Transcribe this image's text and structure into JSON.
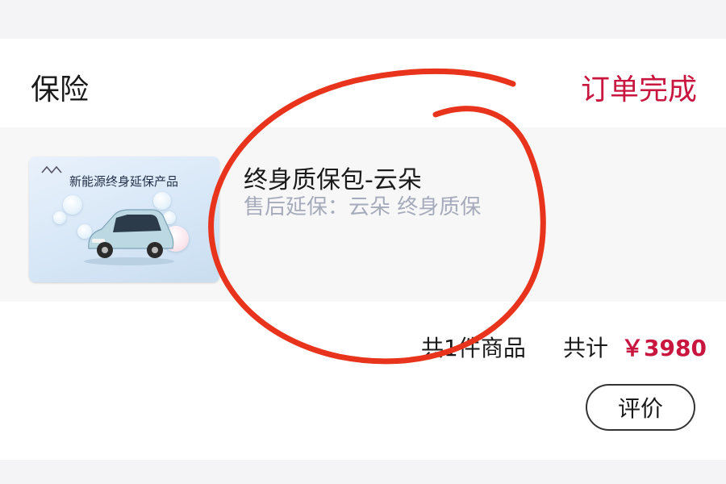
{
  "order": {
    "category": "保险",
    "status": "订单完成",
    "item": {
      "title": "终身质保包-云朵",
      "subtitle": "售后延保：云朵 终身质保",
      "thumbnail": {
        "headline": "新能源终身延保产品"
      }
    },
    "summary": {
      "count_text": "共1件商品",
      "total_label": "共计",
      "total_price": "￥3980"
    },
    "actions": {
      "review_label": "评价"
    }
  },
  "colors": {
    "accent": "#c8163f",
    "annotation": "#e8341c",
    "subtitle": "#a6abbb"
  }
}
